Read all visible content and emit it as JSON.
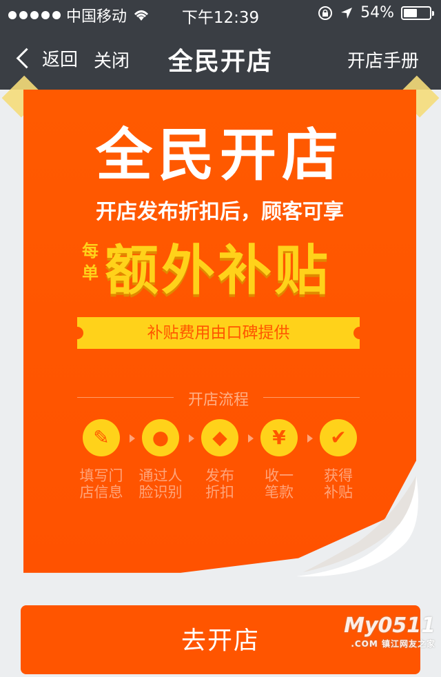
{
  "status_bar": {
    "carrier": "中国移动",
    "time": "下午12:39",
    "battery_percent": "54%",
    "battery_level": 0.54
  },
  "nav": {
    "back_label": "返回",
    "close_label": "关闭",
    "title": "全民开店",
    "manual_label": "开店手册"
  },
  "poster": {
    "logo": "全民开店",
    "line1": "开店发布折扣后，顾客可享",
    "per_order": "每单",
    "headline": "额外补贴",
    "ribbon": "补贴费用由口碑提供",
    "flow_title": "开店流程",
    "steps": [
      {
        "icon": "pencil-icon",
        "glyph": "✎",
        "label_1": "填写门",
        "label_2": "店信息"
      },
      {
        "icon": "person-icon",
        "glyph": "●",
        "label_1": "通过人",
        "label_2": "脸识别"
      },
      {
        "icon": "tag-icon",
        "glyph": "◆",
        "label_1": "发布",
        "label_2": "折扣"
      },
      {
        "icon": "yen-icon",
        "glyph": "¥",
        "label_1": "收一",
        "label_2": "笔款"
      },
      {
        "icon": "check-icon",
        "glyph": "✔",
        "label_1": "获得",
        "label_2": "补贴"
      }
    ]
  },
  "cta": {
    "label": "去开店"
  },
  "watermark": {
    "brand": "My0511",
    "sub": ".COM 镇江网友之家"
  },
  "colors": {
    "nav_bg": "#3a3e44",
    "accent": "#ff5500",
    "gold": "#ffd21a"
  }
}
